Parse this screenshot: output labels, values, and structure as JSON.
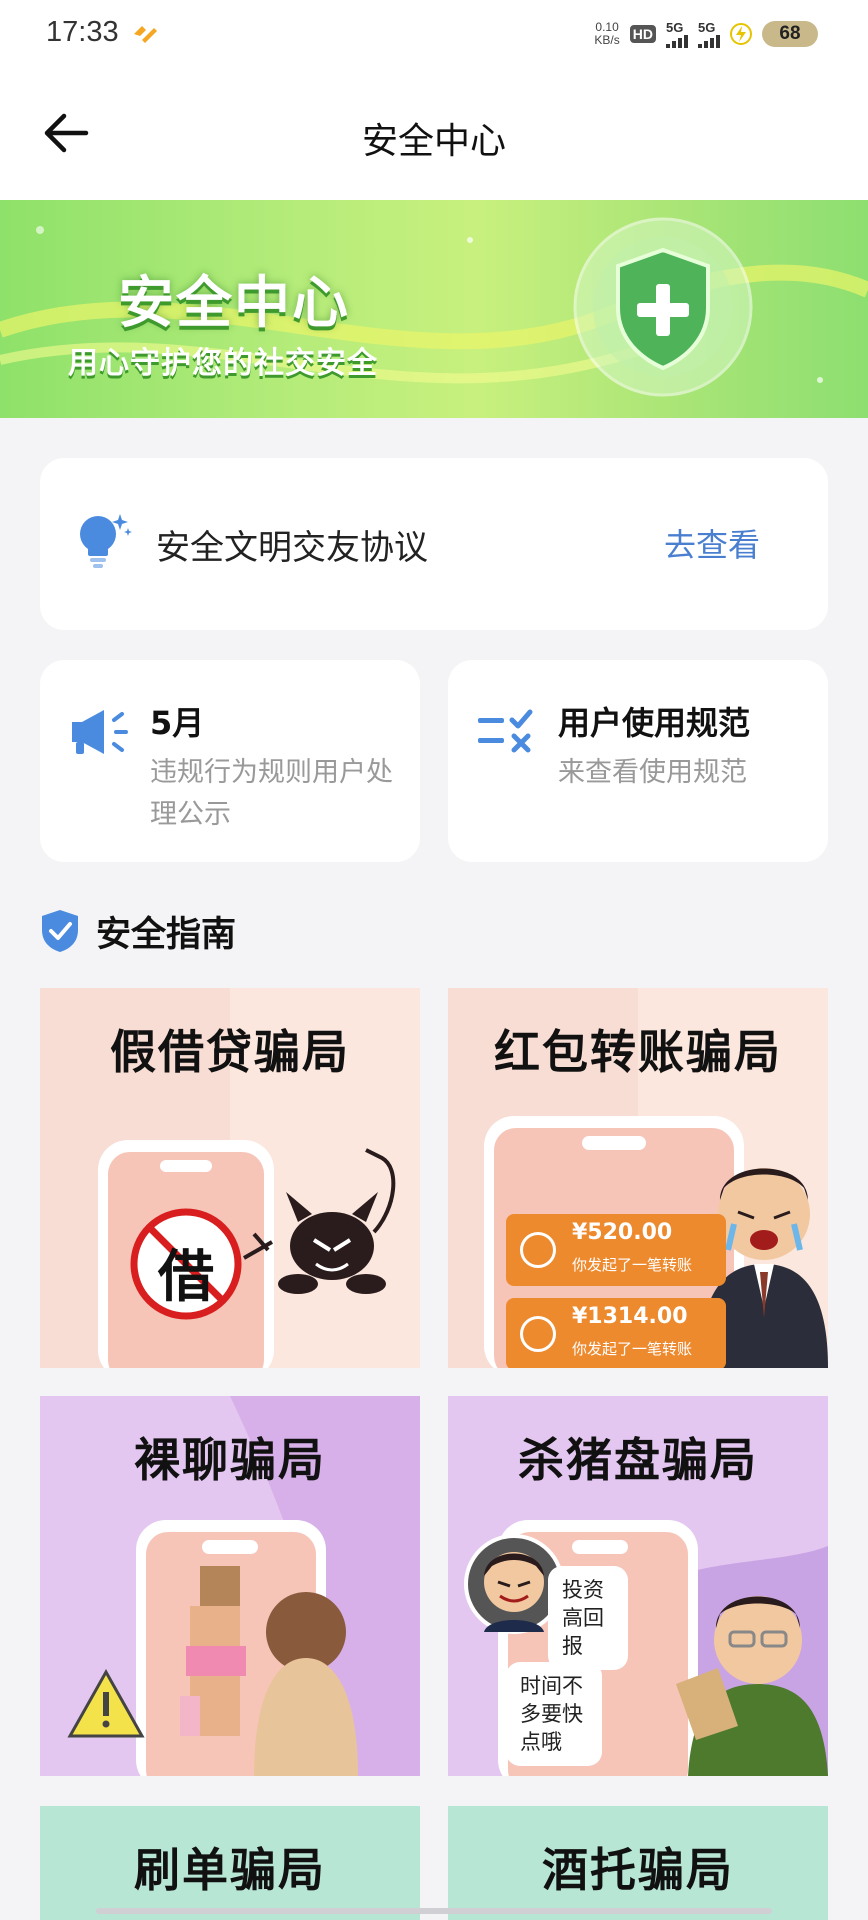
{
  "status_bar": {
    "time": "17:33",
    "net_speed_value": "0.10",
    "net_speed_unit": "KB/s",
    "hd": "HD",
    "sim1": "5G",
    "sim2": "5G",
    "battery": "68"
  },
  "nav": {
    "title": "安全中心",
    "back_icon": "arrow-left-icon"
  },
  "banner": {
    "title": "安全中心",
    "subtitle": "用心守护您的社交安全"
  },
  "agreement": {
    "label": "安全文明交友协议",
    "link": "去查看",
    "icon": "lightbulb-icon"
  },
  "notice": {
    "title": "5月",
    "desc": "违规行为规则用户处理公示",
    "icon": "megaphone-icon"
  },
  "rules": {
    "title": "用户使用规范",
    "desc": "来查看使用规范",
    "icon": "checklist-icon"
  },
  "guide": {
    "title": "安全指南",
    "items": [
      {
        "title": "假借贷骗局",
        "badge_char": "借"
      },
      {
        "title": "红包转账骗局",
        "transfers": [
          {
            "amount": "¥520.00",
            "desc": "你发起了一笔转账"
          },
          {
            "amount": "¥1314.00",
            "desc": "你发起了一笔转账"
          }
        ]
      },
      {
        "title": "裸聊骗局"
      },
      {
        "title": "杀猪盘骗局",
        "bubbles": [
          "投资高回报",
          "时间不多要快点哦"
        ]
      },
      {
        "title": "刷单骗局"
      },
      {
        "title": "酒托骗局"
      }
    ]
  },
  "colors": {
    "accent_link": "#4a7fd0",
    "banner_green": "#8ee16a",
    "icon_blue": "#4a8bdf"
  }
}
